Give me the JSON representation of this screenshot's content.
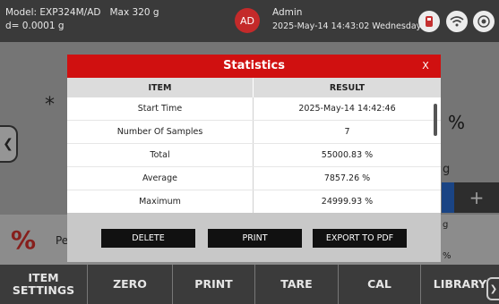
{
  "topbar": {
    "model": "Model: EXP324M/AD   Max 320 g",
    "resolution": "d= 0.0001 g",
    "avatar": "AD",
    "user": "Admin",
    "datetime": "2025-May-14 14:43:02 Wednesday",
    "icons": [
      "usb-icon",
      "wifi-icon",
      "target-icon"
    ]
  },
  "background": {
    "asterisk": "*",
    "percent": "%",
    "unit_g": "g",
    "plus": "+",
    "logo": "%",
    "pe": "Pe",
    "unit_g2": "g",
    "percent_small": "%"
  },
  "modal": {
    "title": "Statistics",
    "close": "X",
    "columns": [
      "ITEM",
      "RESULT"
    ],
    "rows": [
      {
        "item": "Start Time",
        "result": "2025-May-14 14:42:46"
      },
      {
        "item": "Number Of Samples",
        "result": "7"
      },
      {
        "item": "Total",
        "result": "55000.83 %"
      },
      {
        "item": "Average",
        "result": "7857.26 %"
      },
      {
        "item": "Maximum",
        "result": "24999.93 %"
      }
    ],
    "buttons": {
      "delete": "DELETE",
      "print": "PRINT",
      "export": "EXPORT TO PDF"
    }
  },
  "bottom_nav": [
    {
      "label": "ITEM\nSETTINGS"
    },
    {
      "label": "ZERO"
    },
    {
      "label": "PRINT"
    },
    {
      "label": "TARE"
    },
    {
      "label": "CAL"
    },
    {
      "label": "LIBRARY"
    }
  ],
  "colors": {
    "header_red": "#d01010",
    "avatar_red": "#c42a2a",
    "accent_blue": "#2b6ed6"
  }
}
